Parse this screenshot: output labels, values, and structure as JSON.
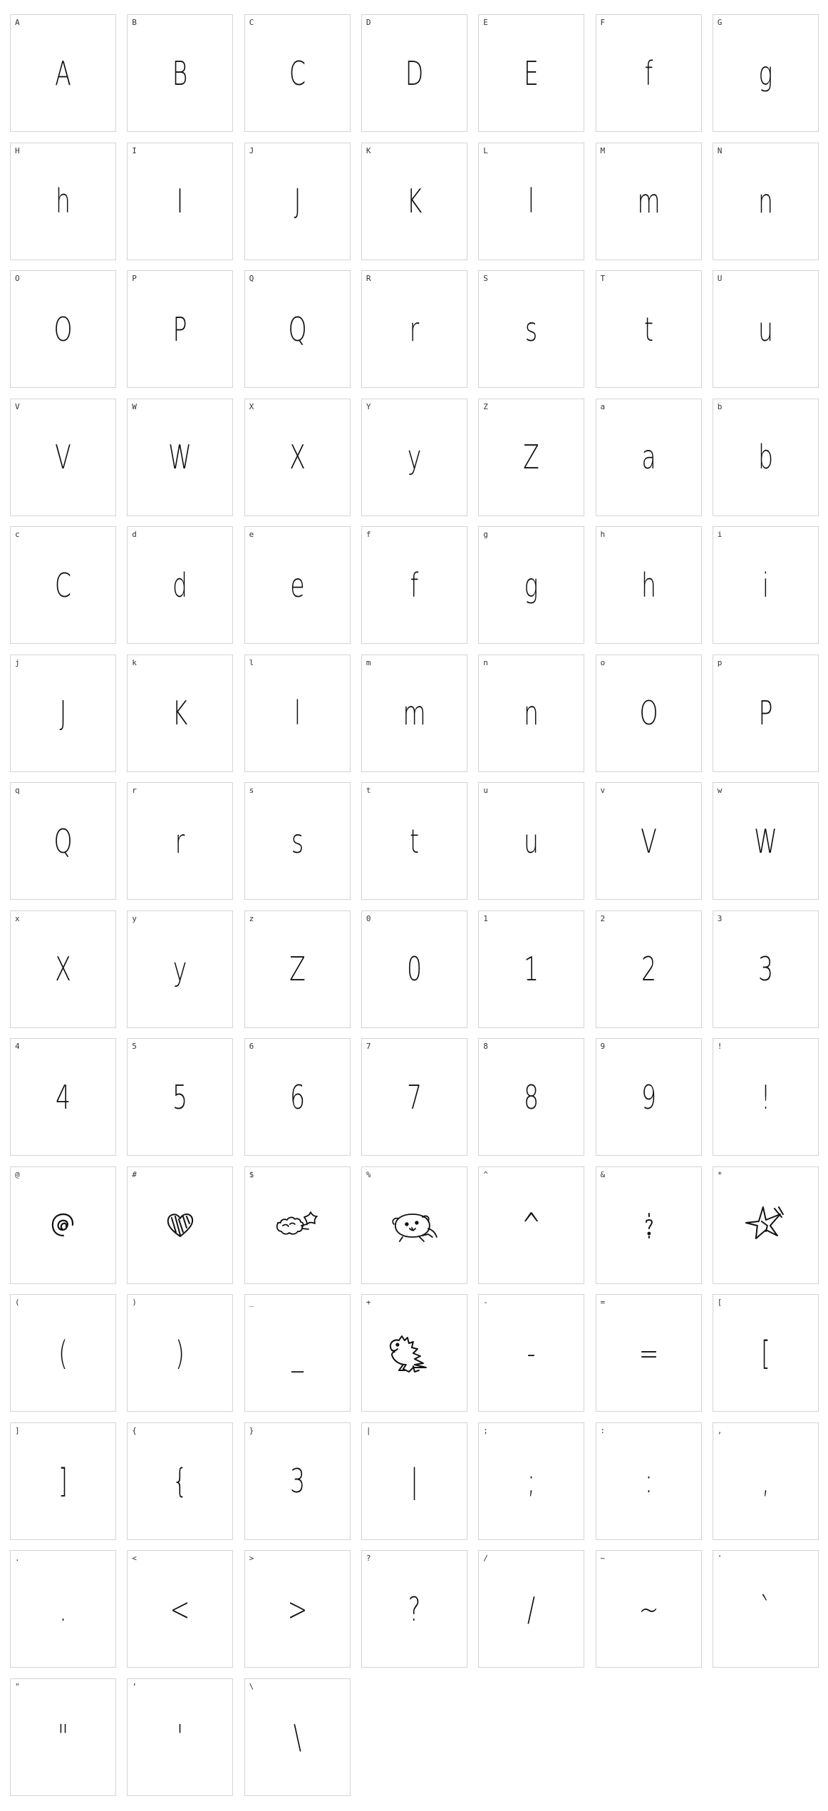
{
  "glyphs": [
    {
      "label": "A",
      "glyph": "A"
    },
    {
      "label": "B",
      "glyph": "B"
    },
    {
      "label": "C",
      "glyph": "C"
    },
    {
      "label": "D",
      "glyph": "D"
    },
    {
      "label": "E",
      "glyph": "E"
    },
    {
      "label": "F",
      "glyph": "f"
    },
    {
      "label": "G",
      "glyph": "g"
    },
    {
      "label": "H",
      "glyph": "h"
    },
    {
      "label": "I",
      "glyph": "I"
    },
    {
      "label": "J",
      "glyph": "J"
    },
    {
      "label": "K",
      "glyph": "K"
    },
    {
      "label": "L",
      "glyph": "l"
    },
    {
      "label": "M",
      "glyph": "m"
    },
    {
      "label": "N",
      "glyph": "n"
    },
    {
      "label": "O",
      "glyph": "O"
    },
    {
      "label": "P",
      "glyph": "P"
    },
    {
      "label": "Q",
      "glyph": "Q"
    },
    {
      "label": "R",
      "glyph": "r"
    },
    {
      "label": "S",
      "glyph": "s"
    },
    {
      "label": "T",
      "glyph": "t"
    },
    {
      "label": "U",
      "glyph": "u"
    },
    {
      "label": "V",
      "glyph": "V"
    },
    {
      "label": "W",
      "glyph": "W"
    },
    {
      "label": "X",
      "glyph": "X"
    },
    {
      "label": "Y",
      "glyph": "y"
    },
    {
      "label": "Z",
      "glyph": "Z"
    },
    {
      "label": "a",
      "glyph": "a"
    },
    {
      "label": "b",
      "glyph": "b"
    },
    {
      "label": "c",
      "glyph": "C"
    },
    {
      "label": "d",
      "glyph": "d"
    },
    {
      "label": "e",
      "glyph": "e"
    },
    {
      "label": "f",
      "glyph": "f"
    },
    {
      "label": "g",
      "glyph": "g"
    },
    {
      "label": "h",
      "glyph": "h"
    },
    {
      "label": "i",
      "glyph": "i"
    },
    {
      "label": "j",
      "glyph": "J"
    },
    {
      "label": "k",
      "glyph": "K"
    },
    {
      "label": "l",
      "glyph": "l"
    },
    {
      "label": "m",
      "glyph": "m"
    },
    {
      "label": "n",
      "glyph": "n"
    },
    {
      "label": "o",
      "glyph": "O"
    },
    {
      "label": "p",
      "glyph": "P"
    },
    {
      "label": "q",
      "glyph": "Q"
    },
    {
      "label": "r",
      "glyph": "r"
    },
    {
      "label": "s",
      "glyph": "s"
    },
    {
      "label": "t",
      "glyph": "t"
    },
    {
      "label": "u",
      "glyph": "u"
    },
    {
      "label": "v",
      "glyph": "V"
    },
    {
      "label": "w",
      "glyph": "W"
    },
    {
      "label": "x",
      "glyph": "X"
    },
    {
      "label": "y",
      "glyph": "y"
    },
    {
      "label": "z",
      "glyph": "Z"
    },
    {
      "label": "0",
      "glyph": "0"
    },
    {
      "label": "1",
      "glyph": "1"
    },
    {
      "label": "2",
      "glyph": "2"
    },
    {
      "label": "3",
      "glyph": "3"
    },
    {
      "label": "4",
      "glyph": "4"
    },
    {
      "label": "5",
      "glyph": "5"
    },
    {
      "label": "6",
      "glyph": "6"
    },
    {
      "label": "7",
      "glyph": "7"
    },
    {
      "label": "8",
      "glyph": "8"
    },
    {
      "label": "9",
      "glyph": "9"
    },
    {
      "label": "!",
      "glyph": "!"
    },
    {
      "label": "@",
      "glyph": "",
      "icon": "swirl-circle-icon"
    },
    {
      "label": "#",
      "glyph": "",
      "icon": "heart-icon"
    },
    {
      "label": "$",
      "glyph": "",
      "icon": "shooting-star-icon"
    },
    {
      "label": "%",
      "glyph": "",
      "icon": "bear-face-icon"
    },
    {
      "label": "^",
      "glyph": "^"
    },
    {
      "label": "&",
      "glyph": "",
      "icon": "ampersand-doodle-icon"
    },
    {
      "label": "*",
      "glyph": "",
      "icon": "star-icon"
    },
    {
      "label": "(",
      "glyph": "("
    },
    {
      "label": ")",
      "glyph": ")"
    },
    {
      "label": "_",
      "glyph": "_"
    },
    {
      "label": "+",
      "glyph": "",
      "icon": "dinosaur-icon"
    },
    {
      "label": "-",
      "glyph": "-"
    },
    {
      "label": "=",
      "glyph": "="
    },
    {
      "label": "[",
      "glyph": "["
    },
    {
      "label": "]",
      "glyph": "]"
    },
    {
      "label": "{",
      "glyph": "{"
    },
    {
      "label": "}",
      "glyph": "3"
    },
    {
      "label": "|",
      "glyph": "|"
    },
    {
      "label": ";",
      "glyph": ";"
    },
    {
      "label": ":",
      "glyph": ":"
    },
    {
      "label": ",",
      "glyph": ","
    },
    {
      "label": ".",
      "glyph": "."
    },
    {
      "label": "<",
      "glyph": "<"
    },
    {
      "label": ">",
      "glyph": ">"
    },
    {
      "label": "?",
      "glyph": "?"
    },
    {
      "label": "/",
      "glyph": "/"
    },
    {
      "label": "~",
      "glyph": "~"
    },
    {
      "label": "'",
      "glyph": "`"
    },
    {
      "label": "\"",
      "glyph": "\""
    },
    {
      "label": "’",
      "glyph": "'"
    },
    {
      "label": "\\",
      "glyph": "\\"
    }
  ]
}
